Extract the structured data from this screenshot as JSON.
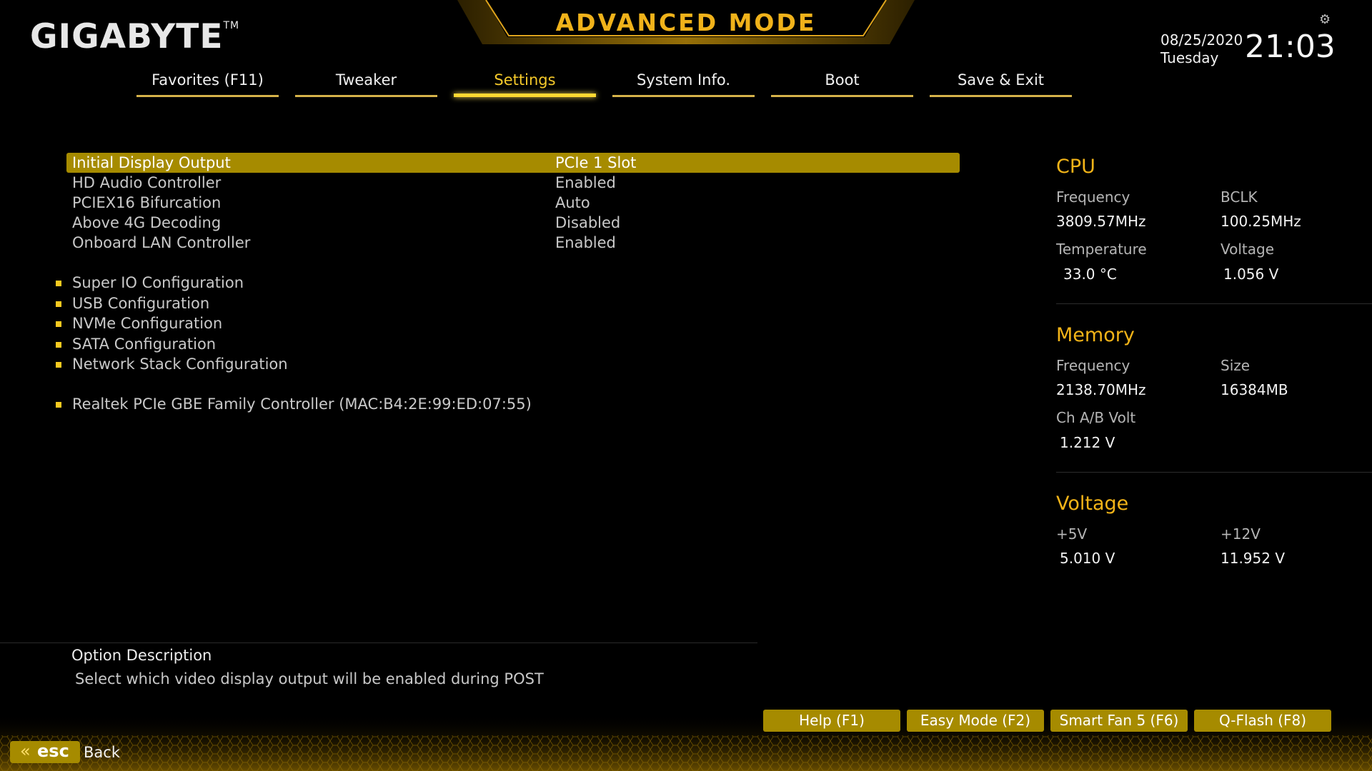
{
  "header": {
    "brand": "GIGABYTE",
    "brand_tm": "TM",
    "mode_title": "ADVANCED MODE",
    "date": "08/25/2020",
    "weekday": "Tuesday",
    "time": "21:03",
    "icon_settings": "gear-icon"
  },
  "tabs": [
    {
      "label": "Favorites (F11)"
    },
    {
      "label": "Tweaker"
    },
    {
      "label": "Settings",
      "active": true
    },
    {
      "label": "System Info."
    },
    {
      "label": "Boot"
    },
    {
      "label": "Save & Exit"
    }
  ],
  "settings": [
    {
      "label": "Initial Display Output",
      "value": "PCIe 1 Slot",
      "selected": true
    },
    {
      "label": "HD Audio Controller",
      "value": "Enabled"
    },
    {
      "label": "PCIEX16 Bifurcation",
      "value": "Auto"
    },
    {
      "label": "Above 4G Decoding",
      "value": "Disabled"
    },
    {
      "label": "Onboard LAN Controller",
      "value": "Enabled"
    }
  ],
  "submenus": [
    {
      "label": "Super IO Configuration"
    },
    {
      "label": "USB Configuration"
    },
    {
      "label": "NVMe Configuration"
    },
    {
      "label": "SATA Configuration"
    },
    {
      "label": "Network Stack Configuration"
    },
    {
      "label": "Realtek PCIe GBE Family Controller (MAC:B4:2E:99:ED:07:55)"
    }
  ],
  "info": {
    "cpu": {
      "title": "CPU",
      "frequency_label": "Frequency",
      "frequency": "3809.57MHz",
      "bclk_label": "BCLK",
      "bclk": "100.25MHz",
      "temperature_label": "Temperature",
      "temperature": "33.0 °C",
      "voltage_label": "Voltage",
      "voltage": "1.056 V"
    },
    "memory": {
      "title": "Memory",
      "frequency_label": "Frequency",
      "frequency": "2138.70MHz",
      "size_label": "Size",
      "size": "16384MB",
      "chab_label": "Ch A/B Volt",
      "chab": "1.212 V"
    },
    "voltage": {
      "title": "Voltage",
      "v5_label": "+5V",
      "v5": "5.010 V",
      "v12_label": "+12V",
      "v12": "11.952 V"
    }
  },
  "description": {
    "title": "Option Description",
    "text": "Select which video display output will be enabled during POST"
  },
  "footer": {
    "buttons": [
      {
        "label": "Help (F1)"
      },
      {
        "label": "Easy Mode (F2)"
      },
      {
        "label": "Smart Fan 5 (F6)"
      },
      {
        "label": "Q-Flash (F8)"
      }
    ],
    "esc_label": "esc",
    "back_label": "Back"
  },
  "colors": {
    "accent": "#f3b418",
    "highlight_bg": "#a68b00",
    "background": "#000000"
  }
}
